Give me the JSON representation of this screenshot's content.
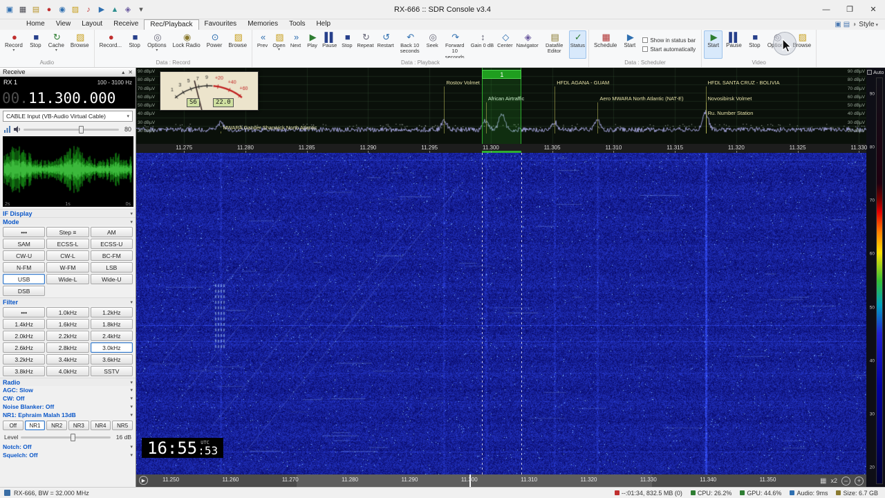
{
  "titlebar": {
    "title": "RX-666 :: SDR Console v3.4",
    "qat_icons": [
      {
        "name": "app-icon",
        "glyph": "▣",
        "color": "#2f6fb0"
      },
      {
        "name": "displays-icon",
        "glyph": "▦",
        "color": "#4a4a52"
      },
      {
        "name": "memories-icon",
        "glyph": "▤",
        "color": "#b8952a"
      },
      {
        "name": "record-icon",
        "glyph": "●",
        "color": "#c03030"
      },
      {
        "name": "world-icon",
        "glyph": "◉",
        "color": "#2f6fb0"
      },
      {
        "name": "folder-icon",
        "glyph": "▨",
        "color": "#c8a020"
      },
      {
        "name": "audio-icon",
        "glyph": "♪",
        "color": "#c03030"
      },
      {
        "name": "play-icon",
        "glyph": "▶",
        "color": "#2f6fb0"
      },
      {
        "name": "upload-icon",
        "glyph": "▲",
        "color": "#2f8f8f"
      },
      {
        "name": "tools-icon",
        "glyph": "◈",
        "color": "#6a5a9f"
      },
      {
        "name": "qat-caret-icon",
        "glyph": "▾",
        "color": "#555555"
      }
    ],
    "window_controls": [
      {
        "name": "minimize-button",
        "glyph": "—"
      },
      {
        "name": "maximize-button",
        "glyph": "❐"
      },
      {
        "name": "close-button",
        "glyph": "✕"
      }
    ]
  },
  "menubar": {
    "tabs": [
      {
        "label": "Home"
      },
      {
        "label": "View"
      },
      {
        "label": "Layout"
      },
      {
        "label": "Receive"
      },
      {
        "label": "Rec/Playback",
        "active": true
      },
      {
        "label": "Favourites"
      },
      {
        "label": "Memories"
      },
      {
        "label": "Tools"
      },
      {
        "label": "Help"
      }
    ],
    "right_icons": [
      {
        "name": "monitor-icon",
        "glyph": "▣",
        "color": "#4a78b0"
      },
      {
        "name": "layout-icon",
        "glyph": "▤",
        "color": "#4a78b0"
      },
      {
        "name": "style-icon",
        "glyph": "◑",
        "color": "#888888"
      }
    ],
    "style_label": "Style"
  },
  "ribbon": {
    "groups": [
      {
        "label": "Audio",
        "buttons": [
          {
            "label": "Record",
            "name": "audio-record-button",
            "glyph": "●",
            "color": "#c03030",
            "dropdown": true
          },
          {
            "label": "Stop",
            "name": "audio-stop-button",
            "glyph": "■",
            "color": "#27408b"
          },
          {
            "label": "Cache",
            "name": "audio-cache-button",
            "glyph": "↻",
            "color": "#2e7d32",
            "dropdown": true
          },
          {
            "label": "Browse",
            "name": "audio-browse-button",
            "glyph": "▨",
            "color": "#c8a020"
          }
        ]
      },
      {
        "label": "Data : Record",
        "buttons": [
          {
            "label": "Record...",
            "name": "data-record-button",
            "glyph": "●",
            "color": "#c03030"
          },
          {
            "label": "Stop",
            "name": "data-record-stop-button",
            "glyph": "■",
            "color": "#27408b"
          },
          {
            "label": "Options",
            "name": "data-record-options-button",
            "glyph": "◎",
            "color": "#666677",
            "dropdown": true
          },
          {
            "label": "Lock Radio",
            "name": "lock-radio-button",
            "glyph": "◉",
            "color": "#8a7a30"
          },
          {
            "label": "Power",
            "name": "power-button",
            "glyph": "⊙",
            "color": "#2f6fb0"
          },
          {
            "label": "Browse",
            "name": "data-record-browse-button",
            "glyph": "▨",
            "color": "#c8a020"
          }
        ]
      },
      {
        "label": "Data : Playback",
        "buttons": [
          {
            "label": "Prev",
            "name": "prev-button",
            "glyph": "«",
            "color": "#2f6fb0"
          },
          {
            "label": "Open",
            "name": "open-button",
            "glyph": "▨",
            "color": "#c8a020",
            "dropdown": true
          },
          {
            "label": "Next",
            "name": "next-button",
            "glyph": "»",
            "color": "#2f6fb0"
          },
          {
            "label": "Play",
            "name": "playback-play-button",
            "glyph": "▶",
            "color": "#2e7d32"
          },
          {
            "label": "Pause",
            "name": "playback-pause-button",
            "glyph": "▌▌",
            "color": "#27408b"
          },
          {
            "label": "Stop",
            "name": "playback-stop-button",
            "glyph": "■",
            "color": "#27408b"
          },
          {
            "label": "Repeat",
            "name": "repeat-button",
            "glyph": "↻",
            "color": "#666677"
          },
          {
            "label": "Restart",
            "name": "restart-button",
            "glyph": "↺",
            "color": "#2f6fb0"
          },
          {
            "label": "Back 10 seconds",
            "name": "back-10-seconds-button",
            "glyph": "↶",
            "color": "#2f6fb0"
          },
          {
            "label": "Seek",
            "name": "seek-button",
            "glyph": "◎",
            "color": "#666677"
          },
          {
            "label": "Forward 10 seconds",
            "name": "forward-10-seconds-button",
            "glyph": "↷",
            "color": "#2f6fb0"
          },
          {
            "label": "Gain 0 dB",
            "name": "gain-control",
            "glyph": "↕",
            "color": "#666677"
          },
          {
            "label": "Center",
            "name": "center-button",
            "glyph": "◇",
            "color": "#2f6fb0"
          },
          {
            "label": "Navigator",
            "name": "navigator-button",
            "glyph": "◈",
            "color": "#6a5a9f"
          },
          {
            "label": "Datafile Editor",
            "name": "datafile-editor-button",
            "glyph": "▤",
            "color": "#8a7a30"
          },
          {
            "label": "Status",
            "name": "status-button",
            "glyph": "✓",
            "color": "#2e7d32",
            "highlight": true
          }
        ]
      },
      {
        "label": "Data : Scheduler",
        "buttons": [
          {
            "label": "Schedule",
            "name": "schedule-button",
            "glyph": "▦",
            "color": "#b03030"
          },
          {
            "label": "Start",
            "name": "scheduler-start-button",
            "glyph": "▶",
            "color": "#2f6fb0"
          }
        ],
        "checkboxes": [
          {
            "label": "Show in status bar"
          },
          {
            "label": "Start automatically"
          }
        ]
      },
      {
        "label": "Video",
        "buttons": [
          {
            "label": "Start",
            "name": "video-start-button",
            "glyph": "▶",
            "color": "#2e7d32",
            "highlight": true
          },
          {
            "label": "Pause",
            "name": "video-pause-button",
            "glyph": "▌▌",
            "color": "#27408b"
          },
          {
            "label": "Stop",
            "name": "video-stop-button",
            "glyph": "■",
            "color": "#27408b"
          },
          {
            "label": "Options",
            "name": "video-options-button",
            "glyph": "◎",
            "color": "#666677"
          },
          {
            "label": "Browse",
            "name": "video-browse-button",
            "glyph": "▨",
            "color": "#c8a020"
          }
        ]
      }
    ]
  },
  "receive": {
    "panel_title": "Receive",
    "panel_icons": [
      {
        "name": "collapse-icon",
        "glyph": "▴"
      },
      {
        "name": "close-icon",
        "glyph": "✕"
      }
    ],
    "rx_label": "RX 1",
    "passband": "100 - 3100 Hz",
    "freq_dim": "00.",
    "freq_main": "11.300.000",
    "device": "CABLE Input (VB-Audio Virtual Cable)",
    "volume": "80",
    "wave_times": [
      "2s",
      "1s",
      "0s"
    ],
    "if_display_header": "IF Display",
    "mode_header": "Mode",
    "filter_header": "Filter",
    "radio_header": "Radio",
    "modes": [
      {
        "label": "•••"
      },
      {
        "label": "Step ≡"
      },
      {
        "label": "AM"
      },
      {
        "label": "SAM"
      },
      {
        "label": "ECSS-L"
      },
      {
        "label": "ECSS-U"
      },
      {
        "label": "CW-U"
      },
      {
        "label": "CW-L"
      },
      {
        "label": "BC-FM"
      },
      {
        "label": "N-FM"
      },
      {
        "label": "W-FM"
      },
      {
        "label": "LSB"
      },
      {
        "label": "USB",
        "active": true
      },
      {
        "label": "Wide-L"
      },
      {
        "label": "Wide-U"
      },
      {
        "label": "DSB"
      }
    ],
    "filters": [
      {
        "label": "•••"
      },
      {
        "label": "1.0kHz"
      },
      {
        "label": "1.2kHz"
      },
      {
        "label": "1.4kHz"
      },
      {
        "label": "1.6kHz"
      },
      {
        "label": "1.8kHz"
      },
      {
        "label": "2.0kHz"
      },
      {
        "label": "2.2kHz"
      },
      {
        "label": "2.4kHz"
      },
      {
        "label": "2.6kHz"
      },
      {
        "label": "2.8kHz"
      },
      {
        "label": "3.0kHz",
        "active": true
      },
      {
        "label": "3.2kHz"
      },
      {
        "label": "3.4kHz"
      },
      {
        "label": "3.6kHz"
      },
      {
        "label": "3.8kHz"
      },
      {
        "label": "4.0kHz"
      },
      {
        "label": "SSTV"
      }
    ],
    "radio_rows": [
      {
        "label": "AGC: Slow"
      },
      {
        "label": "CW: Off"
      },
      {
        "label": "Noise Blanker: Off"
      },
      {
        "label": "NR1: Ephraim Malah 13dB"
      }
    ],
    "nr_buttons": [
      {
        "label": "Off"
      },
      {
        "label": "NR1",
        "active": true
      },
      {
        "label": "NR2"
      },
      {
        "label": "NR3"
      },
      {
        "label": "NR4"
      },
      {
        "label": "NR5"
      }
    ],
    "level_label": "Level",
    "level_value": "16 dB",
    "notch": "Notch: Off",
    "squelch": "Squelch: Off"
  },
  "spectrum": {
    "axis": {
      "from_mhz": 11.2711,
      "to_mhz": 11.3306
    },
    "db_labels": [
      "90 dBµV",
      "80 dBµV",
      "70 dBµV",
      "60 dBµV",
      "50 dBµV",
      "40 dBµV",
      "30 dBµV",
      "20 dBµV"
    ],
    "freq_ticks": [
      "11.275",
      "11.280",
      "11.285",
      "11.290",
      "11.295",
      "11.300",
      "11.305",
      "11.310",
      "11.315",
      "11.320",
      "11.325",
      "11.330"
    ],
    "selection": {
      "from_mhz": 11.2993,
      "to_mhz": 11.3025,
      "badge": "1"
    },
    "stations": [
      {
        "name": "MWARA Gander Shanwick North Atlantic",
        "freq_mhz": 11.278,
        "row": 3
      },
      {
        "name": "Rostov Volmet",
        "freq_mhz": 11.2962,
        "row": 0
      },
      {
        "name": "African Airtraffic",
        "freq_mhz": 11.2996,
        "row": 1,
        "highlight": true
      },
      {
        "name": "HFDL AGANA - GUAM",
        "freq_mhz": 11.3052,
        "row": 0
      },
      {
        "name": "Aero MWARA North Atlantic (NAT-E)",
        "freq_mhz": 11.3087,
        "row": 1
      },
      {
        "name": "HFDL SANTA CRUZ - BOLIVIA",
        "freq_mhz": 11.3175,
        "row": 0
      },
      {
        "name": "Novosibirsk Volmet",
        "freq_mhz": 11.3175,
        "row": 1
      },
      {
        "name": "Ru. Number Station",
        "freq_mhz": 11.3175,
        "row": 2
      }
    ],
    "smeter": {
      "s": "S6",
      "db": "22.0",
      "scale": [
        "1",
        "3",
        "5",
        "7",
        "9",
        "+20",
        "+40",
        "+60"
      ]
    }
  },
  "waterfall": {
    "clock": {
      "time": "16:55",
      "seconds": ":53",
      "tz": "UTC"
    },
    "auto_label": "Auto",
    "legend_ticks": [
      "90",
      "80",
      "70",
      "60",
      "50",
      "40",
      "30",
      "20"
    ]
  },
  "overview": {
    "axis": {
      "from_mhz": 11.2442,
      "to_mhz": 11.3665
    },
    "ticks": [
      "11.250",
      "11.260",
      "11.270",
      "11.280",
      "11.290",
      "11.300",
      "11.310",
      "11.320",
      "11.330",
      "11.340",
      "11.350"
    ],
    "marker_mhz": 11.3,
    "zoom_label": "x2",
    "play_glyph": "▶",
    "grid_glyph": "▦",
    "zoom_out_glyph": "–",
    "zoom_in_glyph": "+"
  },
  "statusbar": {
    "left": "RX-666, BW = 32.000 MHz",
    "items": [
      {
        "text": "--:01:34, 832.5 MB (0)",
        "color": "#c03030"
      },
      {
        "text": "CPU: 26.2%",
        "color": "#2e7d32"
      },
      {
        "text": "GPU: 44.6%",
        "color": "#2e7d32"
      },
      {
        "text": "Audio: 9ms",
        "color": "#2f6fb0"
      },
      {
        "text": "Size: 6.7 GB",
        "color": "#8a7a30"
      }
    ]
  }
}
